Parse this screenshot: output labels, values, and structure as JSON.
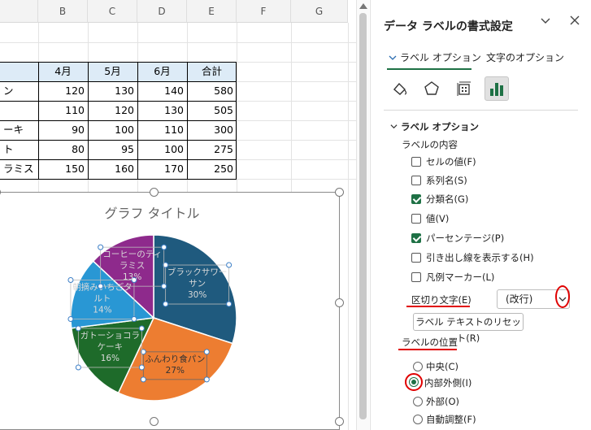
{
  "spreadsheet": {
    "columns": [
      "B",
      "C",
      "D",
      "E",
      "F",
      "G"
    ],
    "table": {
      "headers": [
        "4月",
        "5月",
        "6月",
        "合計"
      ],
      "rows": [
        {
          "label": "ン",
          "values": [
            "120",
            "130",
            "140",
            "580"
          ]
        },
        {
          "label": "",
          "values": [
            "110",
            "120",
            "130",
            "505"
          ]
        },
        {
          "label": "ーキ",
          "values": [
            "90",
            "100",
            "110",
            "300"
          ]
        },
        {
          "label": "ト",
          "values": [
            "80",
            "95",
            "100",
            "275"
          ]
        },
        {
          "label": "ラミス",
          "values": [
            "150",
            "160",
            "170",
            "250"
          ]
        }
      ]
    }
  },
  "chart": {
    "title": "グラフ タイトル",
    "labels": [
      {
        "name": "ブラックサワー\nサン",
        "pct": "30%"
      },
      {
        "name": "ふんわり食パン",
        "pct": "27%"
      },
      {
        "name": "ガトーショコラ\nケーキ",
        "pct": "16%"
      },
      {
        "name": "朝摘みいちごタ\nルト",
        "pct": "14%"
      },
      {
        "name": "コーヒーのティ\nラミス",
        "pct": "13%"
      }
    ]
  },
  "chart_data": {
    "type": "pie",
    "title": "グラフ タイトル",
    "categories": [
      "ブラックサワーサン",
      "ふんわり食パン",
      "ガトーショコラケーキ",
      "朝摘みいちごタルト",
      "コーヒーのティラミス"
    ],
    "values": [
      30,
      27,
      16,
      14,
      13
    ],
    "colors": [
      "#1f5a7e",
      "#ed7d31",
      "#1e6b2a",
      "#2997d4",
      "#8e2a8c"
    ]
  },
  "pane": {
    "title": "データ ラベルの書式設定",
    "collapse_icon": "chevron-down",
    "close_icon": "close",
    "tabs": [
      "ラベル オプション",
      "文字のオプション"
    ],
    "icons": [
      "fill-line-icon",
      "effects-icon",
      "size-properties-icon",
      "label-options-icon"
    ],
    "section": "ラベル オプション",
    "contents_label": "ラベルの内容",
    "checkboxes": [
      {
        "label": "セルの値(F)",
        "checked": false
      },
      {
        "label": "系列名(S)",
        "checked": false
      },
      {
        "label": "分類名(G)",
        "checked": true
      },
      {
        "label": "値(V)",
        "checked": false
      },
      {
        "label": "パーセンテージ(P)",
        "checked": true
      },
      {
        "label": "引き出し線を表示する(H)",
        "checked": false
      },
      {
        "label": "凡例マーカー(L)",
        "checked": false
      }
    ],
    "separator_label": "区切り文字(E)",
    "separator_value": "(改行)",
    "reset_button": "ラベル テキストのリセット(R)",
    "position_label": "ラベルの位置",
    "positions": [
      {
        "label": "中央(C)",
        "selected": false
      },
      {
        "label": "内部外側(I)",
        "selected": true
      },
      {
        "label": "外部(O)",
        "selected": false
      },
      {
        "label": "自動調整(F)",
        "selected": false
      }
    ]
  }
}
